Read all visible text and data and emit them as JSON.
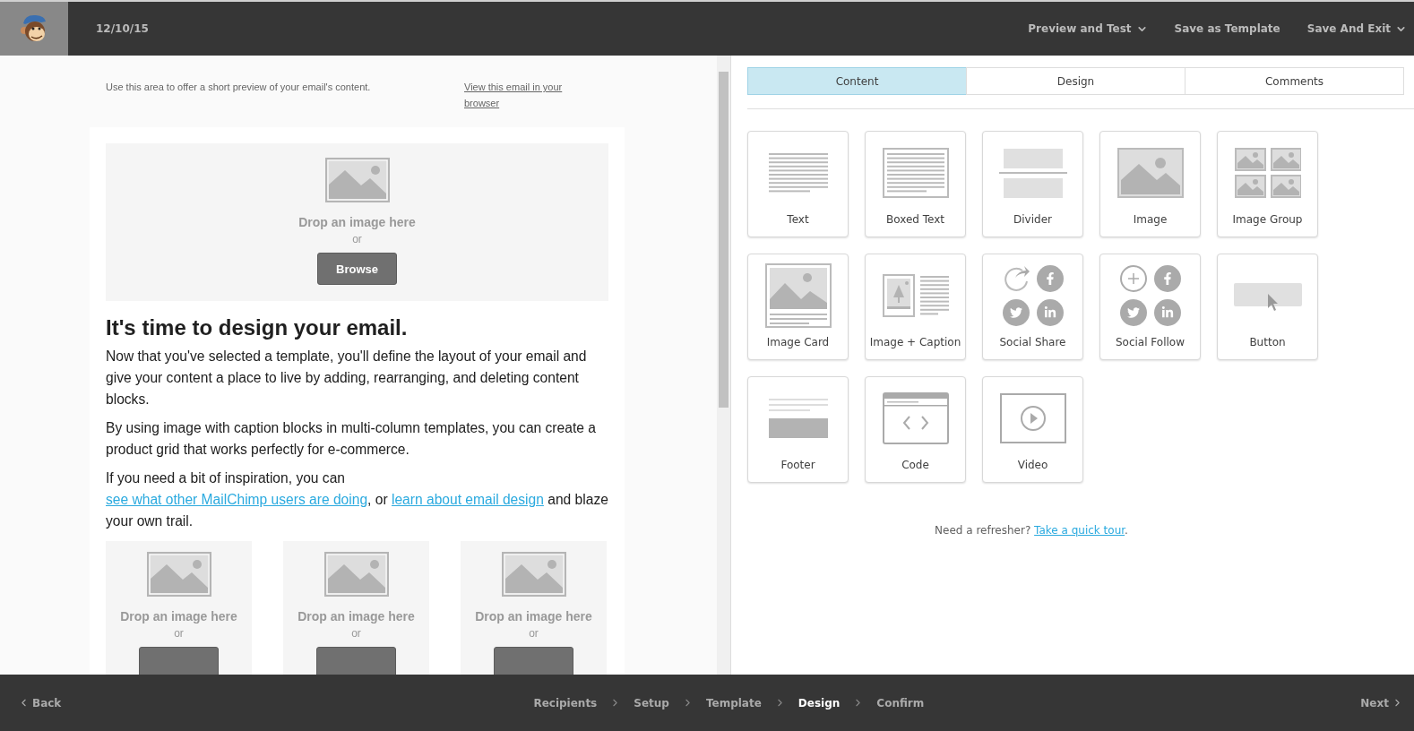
{
  "top_bar": {
    "date": "12/10/15",
    "actions": [
      {
        "label": "Preview and Test",
        "dropdown": true
      },
      {
        "label": "Save as Template",
        "dropdown": false
      },
      {
        "label": "Save And Exit",
        "dropdown": true
      }
    ]
  },
  "email_preview": {
    "preheader": {
      "text": "Use this area to offer a short preview of your email's content.",
      "link": "View this email in your browser"
    },
    "hero_image": {
      "prompt": "Drop an image here",
      "or": "or",
      "button": "Browse"
    },
    "heading": "It's time to design your email.",
    "paragraphs": [
      [
        {
          "kind": "text",
          "text": "Now that you've selected a template, you'll define the layout of your email and give your content a place to live by adding, rearranging, and deleting content blocks."
        }
      ],
      [
        {
          "kind": "text",
          "text": "By using image with caption blocks in multi-column templates, you can create a product grid that works perfectly for e-commerce."
        }
      ],
      [
        {
          "kind": "text",
          "text": "If you need a bit of inspiration, you can "
        },
        {
          "kind": "link",
          "text": "see what other MailChimp users are doing"
        },
        {
          "kind": "text",
          "text": ", or "
        },
        {
          "kind": "link",
          "text": "learn about email design"
        },
        {
          "kind": "text",
          "text": " and blaze your own trail."
        }
      ]
    ],
    "columns": [
      {
        "prompt": "Drop an image here",
        "or": "or"
      },
      {
        "prompt": "Drop an image here",
        "or": "or"
      },
      {
        "prompt": "Drop an image here",
        "or": "or"
      }
    ]
  },
  "panel": {
    "tabs": [
      {
        "label": "Content",
        "selected": true
      },
      {
        "label": "Design",
        "selected": false
      },
      {
        "label": "Comments",
        "selected": false
      }
    ],
    "blocks": [
      {
        "label": "Text",
        "kind": "text"
      },
      {
        "label": "Boxed Text",
        "kind": "boxed"
      },
      {
        "label": "Divider",
        "kind": "divider"
      },
      {
        "label": "Image",
        "kind": "image"
      },
      {
        "label": "Image Group",
        "kind": "group"
      },
      {
        "label": "Image Card",
        "kind": "card"
      },
      {
        "label": "Image + Caption",
        "kind": "caption"
      },
      {
        "label": "Social Share",
        "kind": "share"
      },
      {
        "label": "Social Follow",
        "kind": "follow"
      },
      {
        "label": "Button",
        "kind": "button"
      },
      {
        "label": "Footer",
        "kind": "footer"
      },
      {
        "label": "Code",
        "kind": "code"
      },
      {
        "label": "Video",
        "kind": "video"
      }
    ],
    "refresher": [
      {
        "kind": "text",
        "text": "Need a refresher? "
      },
      {
        "kind": "link",
        "text": "Take a quick tour"
      },
      {
        "kind": "text",
        "text": "."
      }
    ]
  },
  "footer": {
    "back": "Back",
    "steps": [
      {
        "label": "Recipients",
        "selected": false
      },
      {
        "label": "Setup",
        "selected": false
      },
      {
        "label": "Template",
        "selected": false
      },
      {
        "label": "Design",
        "selected": true
      },
      {
        "label": "Confirm",
        "selected": false
      }
    ],
    "next": "Next"
  }
}
